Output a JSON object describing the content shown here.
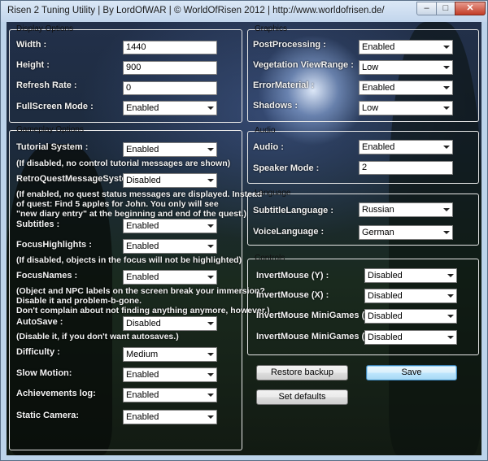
{
  "window": {
    "title": "Risen 2 Tuning Utility | By LordOfWAR | © WorldOfRisen 2012 | http://www.worldofrisen.de/",
    "controls": {
      "minimize": "–",
      "maximize": "□",
      "close": "✕"
    }
  },
  "display_group": {
    "title": "Display Options",
    "width_label": "Width :",
    "width_value": "1440",
    "height_label": "Height :",
    "height_value": "900",
    "refresh_label": "Refresh Rate :",
    "refresh_value": "0",
    "fullscreen_label": "FullScreen Mode :",
    "fullscreen_value": "Enabled"
  },
  "graphics_group": {
    "title": "Graphics",
    "postprocessing_label": "PostProcessing :",
    "postprocessing_value": "Enabled",
    "vegetation_label": "Vegetation ViewRange :",
    "vegetation_value": "Low",
    "errormaterial_label": "ErrorMaterial :",
    "errormaterial_value": "Enabled",
    "shadows_label": "Shadows :",
    "shadows_value": "Low"
  },
  "gameplay_group": {
    "title": "Gameplay Options",
    "tutorial_label": "Tutorial System :",
    "tutorial_value": "Enabled",
    "tutorial_note": "(If disabled, no control tutorial messages are shown)",
    "retroquest_label": "RetroQuestMessageSystem :",
    "retroquest_value": "Disabled",
    "retroquest_note": [
      "(If enabled, no quest status messages are displayed. Instead",
      "of quest: Find 5 apples for John. You only will see",
      "\"new diary entry\" at the beginning and end of the quest.)"
    ],
    "subtitles_label": "Subtitles :",
    "subtitles_value": "Enabled",
    "focushighlights_label": "FocusHighlights :",
    "focushighlights_value": "Enabled",
    "focushighlights_note": "(If disabled, objects in the focus will not be highlighted)",
    "focusnames_label": "FocusNames :",
    "focusnames_value": "Enabled",
    "focusnames_note": [
      "(Object and NPC labels on the screen break your immersion?",
      "Disable it and problem-b-gone.",
      "Don't complain about not finding anything anymore, however.)"
    ],
    "autosave_label": "AutoSave :",
    "autosave_value": "Disabled",
    "autosave_note": "(Disable it, if you don't want autosaves.)",
    "difficulty_label": "Difficulty :",
    "difficulty_value": "Medium",
    "slowmotion_label": "Slow Motion:",
    "slowmotion_value": "Enabled",
    "achievements_label": "Achievements log:",
    "achievements_value": "Enabled",
    "staticcamera_label": "Static Camera:",
    "staticcamera_value": "Enabled"
  },
  "audio_group": {
    "title": "Audio",
    "audio_label": "Audio :",
    "audio_value": "Enabled",
    "speaker_label": "Speaker Mode :",
    "speaker_value": "2"
  },
  "language_group": {
    "title": "Language",
    "subtitle_lang_label": "SubtitleLanguage :",
    "subtitle_lang_value": "Russian",
    "voice_lang_label": "VoiceLanguage :",
    "voice_lang_value": "German"
  },
  "controls_group": {
    "title": "Controls",
    "invert_y_label": "InvertMouse (Y) :",
    "invert_y_value": "Disabled",
    "invert_x_label": "InvertMouse (X) :",
    "invert_x_value": "Disabled",
    "invert_mg_y_label": "InvertMouse MiniGames (Y) :",
    "invert_mg_y_value": "Disabled",
    "invert_mg_x_label": "InvertMouse MiniGames (X) :",
    "invert_mg_x_value": "Disabled"
  },
  "buttons": {
    "restore": "Restore backup",
    "save": "Save",
    "defaults": "Set defaults"
  }
}
